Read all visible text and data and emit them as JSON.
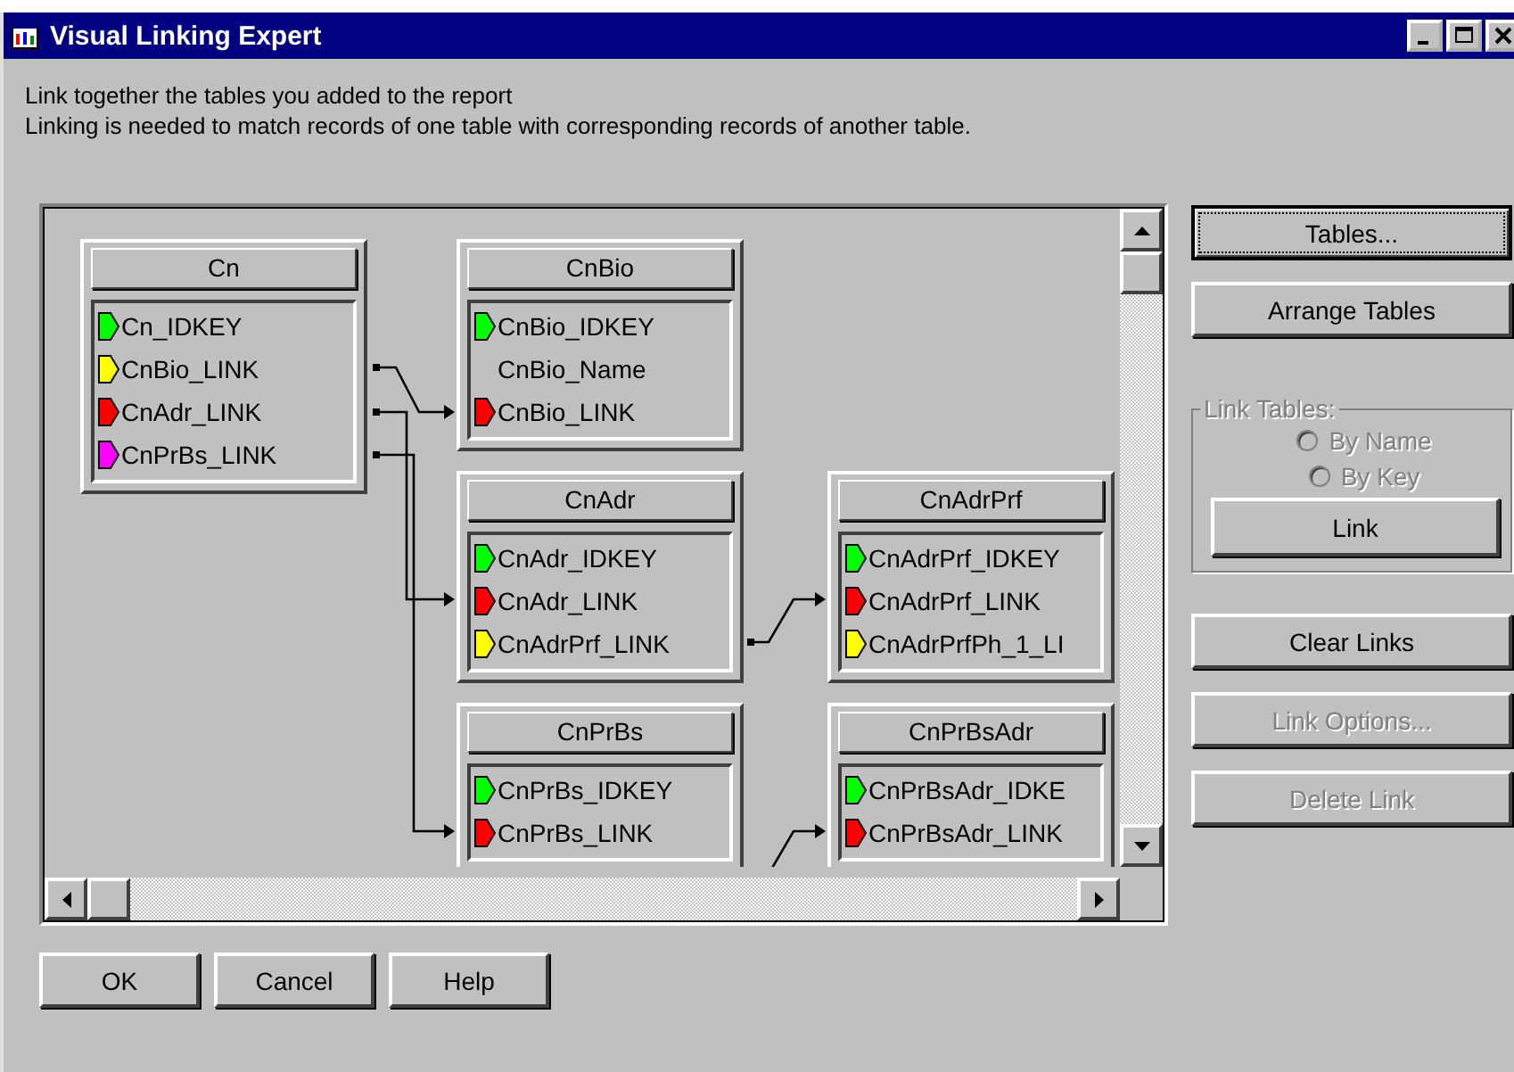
{
  "window": {
    "title": "Visual Linking Expert"
  },
  "description": [
    "Link together the tables you added to the report",
    "Linking is needed to match records of one table with corresponding records of another table."
  ],
  "tables": [
    {
      "name": "Cn",
      "fields": [
        {
          "name": "Cn_IDKEY",
          "color": "#00ff00"
        },
        {
          "name": "CnBio_LINK",
          "color": "#ffff00"
        },
        {
          "name": "CnAdr_LINK",
          "color": "#ff0000"
        },
        {
          "name": "CnPrBs_LINK",
          "color": "#ff00ff"
        }
      ]
    },
    {
      "name": "CnBio",
      "fields": [
        {
          "name": "CnBio_IDKEY",
          "color": "#00ff00"
        },
        {
          "name": "CnBio_Name"
        },
        {
          "name": "CnBio_LINK",
          "color": "#ff0000"
        }
      ]
    },
    {
      "name": "CnAdr",
      "fields": [
        {
          "name": "CnAdr_IDKEY",
          "color": "#00ff00"
        },
        {
          "name": "CnAdr_LINK",
          "color": "#ff0000"
        },
        {
          "name": "CnAdrPrf_LINK",
          "color": "#ffff00"
        }
      ]
    },
    {
      "name": "CnAdrPrf",
      "fields": [
        {
          "name": "CnAdrPrf_IDKEY",
          "color": "#00ff00"
        },
        {
          "name": "CnAdrPrf_LINK",
          "color": "#ff0000"
        },
        {
          "name": "CnAdrPrfPh_1_LI",
          "color": "#ffff00"
        }
      ]
    },
    {
      "name": "CnPrBs",
      "fields": [
        {
          "name": "CnPrBs_IDKEY",
          "color": "#00ff00"
        },
        {
          "name": "CnPrBs_LINK",
          "color": "#ff0000"
        }
      ]
    },
    {
      "name": "CnPrBsAdr",
      "fields": [
        {
          "name": "CnPrBsAdr_IDKE",
          "color": "#00ff00"
        },
        {
          "name": "CnPrBsAdr_LINK",
          "color": "#ff0000"
        }
      ]
    }
  ],
  "side_buttons_top": [
    {
      "label": "Tables...",
      "disabled": false,
      "focused": true
    },
    {
      "label": "Arrange Tables",
      "disabled": false,
      "focused": false
    }
  ],
  "link_tables": {
    "title": "Link Tables:",
    "disabled": true,
    "options": [
      {
        "label": "By Name",
        "selected": false
      },
      {
        "label": "By Key",
        "selected": false
      }
    ],
    "button": "Link"
  },
  "side_buttons_bottom": [
    {
      "label": "Clear Links",
      "disabled": false,
      "focused": false
    },
    {
      "label": "Link Options...",
      "disabled": true,
      "focused": false
    },
    {
      "label": "Delete Link",
      "disabled": true,
      "focused": false
    }
  ],
  "footer_buttons": [
    "OK",
    "Cancel",
    "Help"
  ]
}
